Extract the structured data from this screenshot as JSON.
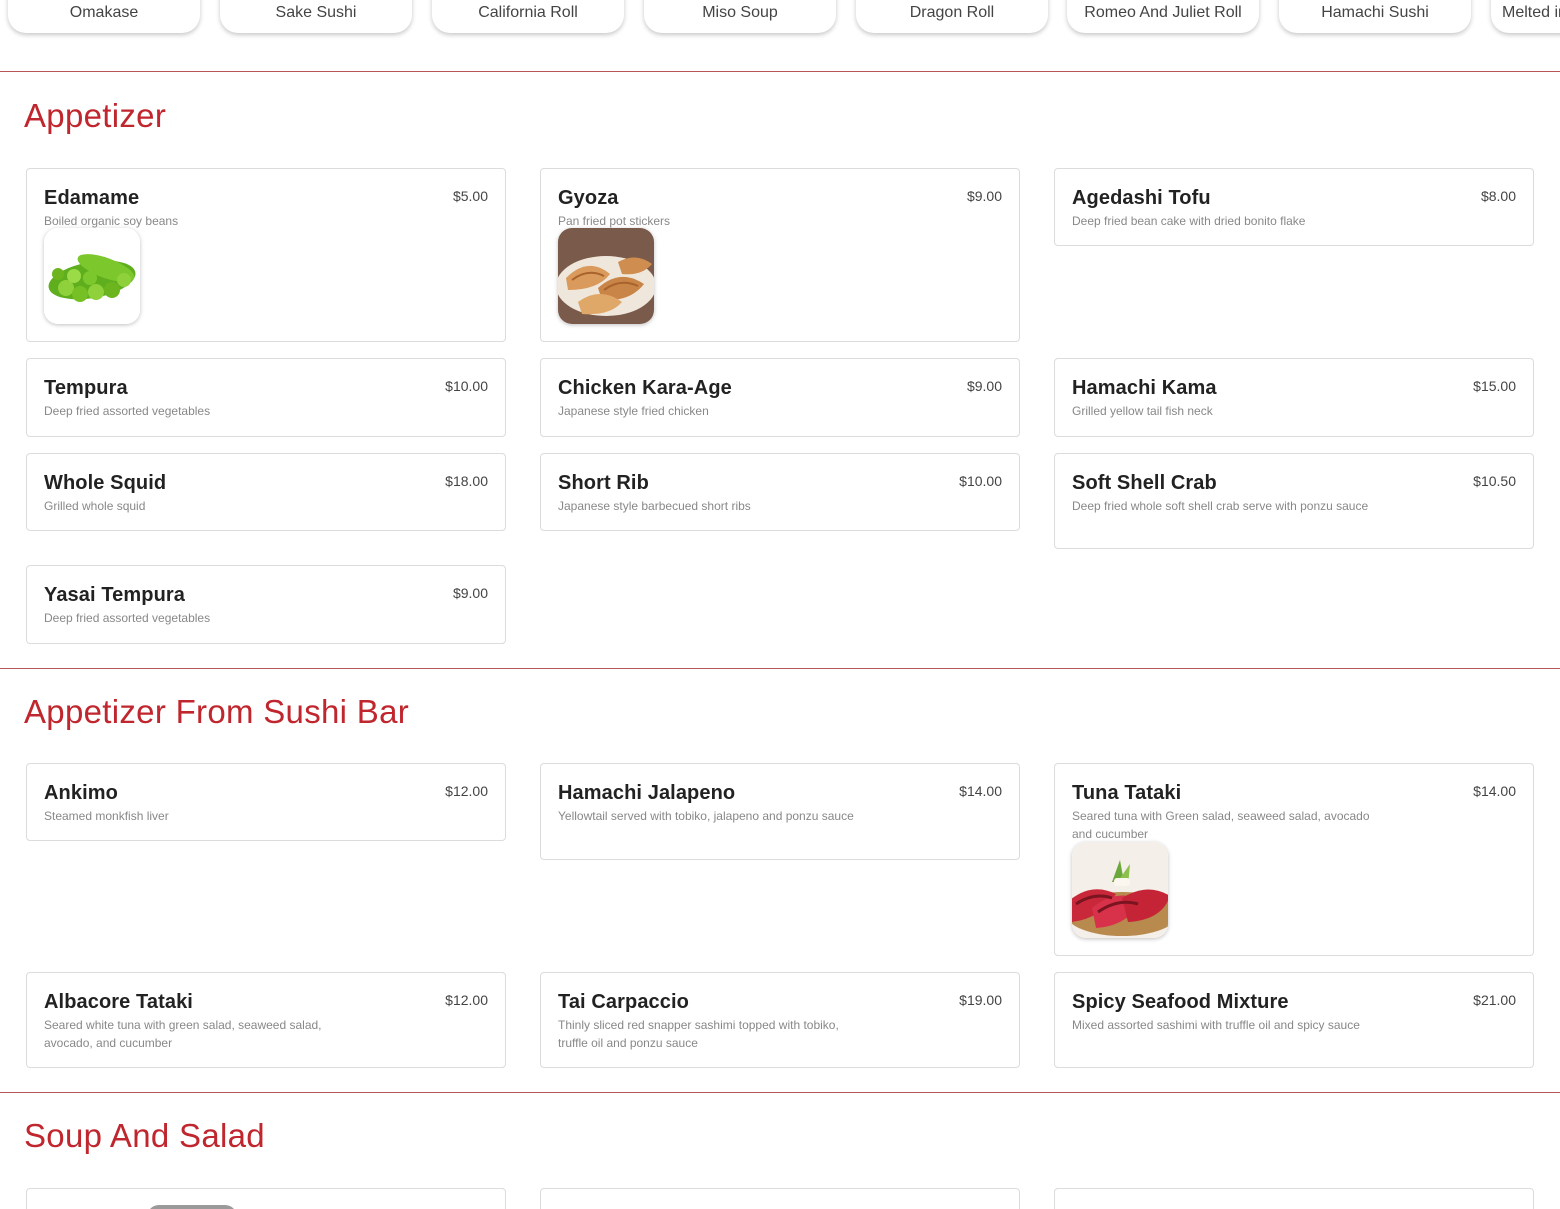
{
  "categories": [
    "Omakase",
    "Sake Sushi",
    "California Roll",
    "Miso Soup",
    "Dragon Roll",
    "Romeo And Juliet Roll",
    "Hamachi Sushi",
    "Melted in"
  ],
  "sections": [
    {
      "title": "Appetizer",
      "items": [
        {
          "name": "Edamame",
          "price": "$5.00",
          "desc": "Boiled organic soy beans",
          "image": "edamame-image"
        },
        {
          "name": "Gyoza",
          "price": "$9.00",
          "desc": "Pan fried pot stickers",
          "image": "gyoza-image"
        },
        {
          "name": "Agedashi Tofu",
          "price": "$8.00",
          "desc": "Deep fried bean cake with dried bonito flake"
        },
        {
          "name": "Tempura",
          "price": "$10.00",
          "desc": "Deep fried assorted vegetables"
        },
        {
          "name": "Chicken Kara-Age",
          "price": "$9.00",
          "desc": "Japanese style fried chicken"
        },
        {
          "name": "Hamachi Kama",
          "price": "$15.00",
          "desc": "Grilled yellow tail fish neck"
        },
        {
          "name": "Whole Squid",
          "price": "$18.00",
          "desc": "Grilled whole squid"
        },
        {
          "name": "Short Rib",
          "price": "$10.00",
          "desc": "Japanese style barbecued short ribs"
        },
        {
          "name": "Soft Shell Crab",
          "price": "$10.50",
          "desc": "Deep fried whole soft shell crab serve with ponzu sauce"
        },
        {
          "name": "Yasai Tempura",
          "price": "$9.00",
          "desc": "Deep fried assorted vegetables"
        }
      ]
    },
    {
      "title": "Appetizer From Sushi Bar",
      "items": [
        {
          "name": "Ankimo",
          "price": "$12.00",
          "desc": "Steamed monkfish liver"
        },
        {
          "name": "Hamachi Jalapeno",
          "price": "$14.00",
          "desc": "Yellowtail served with tobiko, jalapeno and ponzu sauce"
        },
        {
          "name": "Tuna Tataki",
          "price": "$14.00",
          "desc": "Seared tuna with Green salad, seaweed salad, avocado and cucumber",
          "image": "tuna-tataki-image"
        },
        {
          "name": "Albacore Tataki",
          "price": "$12.00",
          "desc": "Seared white tuna with green salad, seaweed salad, avocado, and cucumber"
        },
        {
          "name": "Tai Carpaccio",
          "price": "$19.00",
          "desc": "Thinly sliced red snapper sashimi topped with tobiko, truffle oil and ponzu sauce"
        },
        {
          "name": "Spicy Seafood Mixture",
          "price": "$21.00",
          "desc": "Mixed assorted sashimi with truffle oil and spicy sauce"
        }
      ]
    },
    {
      "title": "Soup And Salad",
      "items": []
    }
  ],
  "colors": {
    "accent": "#c0262d",
    "divider": "#b8555a",
    "card_border": "#dcdcdc",
    "description": "#888888"
  }
}
